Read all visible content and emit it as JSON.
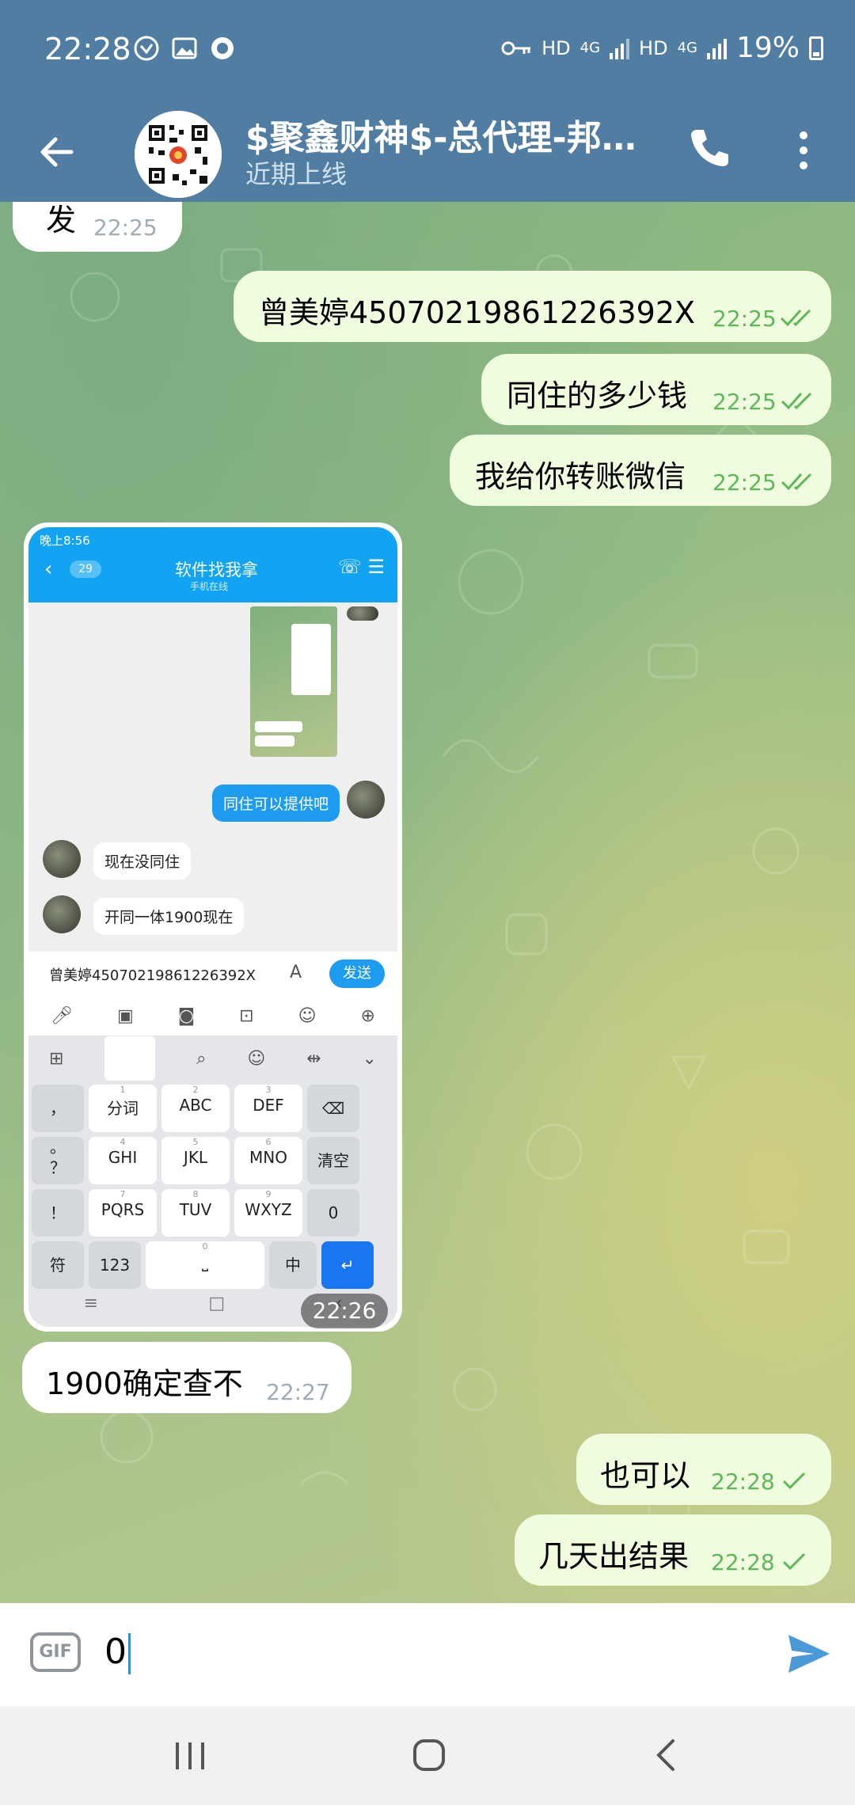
{
  "status_bar": {
    "time": "22:28",
    "hd1": "HD",
    "net1": "4G",
    "hd2": "HD",
    "net2": "4G",
    "battery": "19%"
  },
  "header": {
    "title": "$聚鑫财神$-总代理-邦…",
    "status": "近期上线"
  },
  "messages": [
    {
      "dir": "in",
      "text": "发",
      "time": "22:25"
    },
    {
      "dir": "out",
      "text": "曾美婷45070219861226392X",
      "time": "22:25",
      "read": true
    },
    {
      "dir": "out",
      "text": "同住的多少钱",
      "time": "22:25",
      "read": true
    },
    {
      "dir": "out",
      "text": "我给你转账微信",
      "time": "22:25",
      "read": true
    },
    {
      "dir": "in",
      "type": "image",
      "time": "22:26"
    },
    {
      "dir": "in",
      "text": "1900确定查不",
      "time": "22:27"
    },
    {
      "dir": "out",
      "text": "也可以",
      "time": "22:28",
      "read": false
    },
    {
      "dir": "out",
      "text": "几天出结果",
      "time": "22:28",
      "read": false
    }
  ],
  "embedded_screenshot": {
    "status_time": "晚上8:56",
    "badge": "29",
    "chat_name": "软件找我拿",
    "chat_status": "手机在线",
    "msg_out": "同住可以提供吧",
    "msg_in1": "现在没同住",
    "msg_in2": "开同一体1900现在",
    "input_value": "曾美婷45070219861226392X",
    "send_label": "发送",
    "keys": {
      "row1": [
        "，",
        "分词",
        "ABC",
        "DEF"
      ],
      "row1_sub": [
        "1",
        "2",
        "3"
      ],
      "row2": [
        "。",
        "GHI",
        "JKL",
        "MNO",
        "清空"
      ],
      "row2_sub": [
        "4",
        "5",
        "6"
      ],
      "row2_side": "？",
      "row3": [
        "！",
        "PQRS",
        "TUV",
        "WXYZ",
        "0"
      ],
      "row3_sub": [
        "7",
        "8",
        "9"
      ],
      "row4": [
        "符",
        "123",
        "中"
      ],
      "space_sub": "0"
    }
  },
  "composer": {
    "gif_label": "GIF",
    "input_value": "0"
  }
}
